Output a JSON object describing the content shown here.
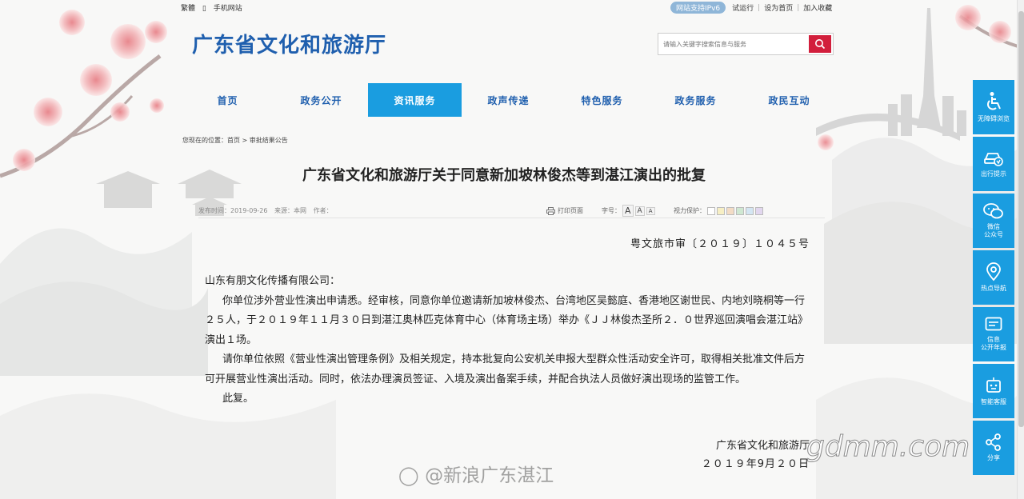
{
  "topbar": {
    "traditional": "繁體",
    "mobile": "手机网站"
  },
  "topright": {
    "ipv6": "网站支持IPv6",
    "trial": "试运行",
    "homepage": "设为首页",
    "favorite": "加入收藏"
  },
  "site": {
    "title": "广东省文化和旅游厅"
  },
  "search": {
    "placeholder": "请输入关键字搜索信息与服务"
  },
  "nav": {
    "items": [
      {
        "label": "首页"
      },
      {
        "label": "政务公开"
      },
      {
        "label": "资讯服务"
      },
      {
        "label": "政声传递"
      },
      {
        "label": "特色服务"
      },
      {
        "label": "政务服务"
      },
      {
        "label": "政民互动"
      }
    ],
    "active_index": 2
  },
  "breadcrumb": {
    "prefix": "您现在的位置：",
    "home": "首页",
    "sep": ">",
    "current": "审批结果公告"
  },
  "article": {
    "title": "广东省文化和旅游厅关于同意新加坡林俊杰等到湛江演出的批复",
    "date": "发布时间：2019-09-26",
    "source": "来源：本网",
    "author": "作者：",
    "print": "打印页面",
    "fontsize": "字号：",
    "font_a1": "A",
    "font_a2": "A",
    "font_a3": "A",
    "vision": "视力保护：",
    "vision_colors": [
      "#ffffff",
      "#f7efc4",
      "#f3dcc5",
      "#cfe8d2",
      "#d4e6f3",
      "#e2d7ef"
    ],
    "doc_no": "粤文旅市审〔２０１９〕１０４５号",
    "p1": "山东有朋文化传播有限公司：",
    "p2": "你单位涉外营业性演出申请悉。经审核，同意你单位邀请新加坡林俊杰、台湾地区吴懿庭、香港地区谢世民、内地刘晓桐等一行２５人，于２０１９年１１月３０日到湛江奥林匹克体育中心（体育场主场）举办《ＪＪ林俊杰圣所２．０世界巡回演唱会湛江站》演出１场。",
    "p3": "请你单位依照《营业性演出管理条例》及相关规定，持本批复向公安机关申报大型群众性活动安全许可，取得相关批准文件后方可开展营业性演出活动。同时，依法办理演员签证、入境及演出备案手续，并配合执法人员做好演出现场的监管工作。",
    "p4": "此复。",
    "sign_org": "广东省文化和旅游厅",
    "sign_date": "２０１９年9月２０日"
  },
  "watermark": {
    "weibo": "@新浪广东湛江",
    "site": "gdmm.com"
  },
  "side": {
    "items": [
      {
        "label": "无障碍浏览",
        "icon": "accessibility-icon"
      },
      {
        "label": "出行提示",
        "icon": "car-icon"
      },
      {
        "label": "微信\n公众号",
        "icon": "wechat-icon"
      },
      {
        "label": "热点导航",
        "icon": "location-icon"
      },
      {
        "label": "信息\n公开年报",
        "icon": "report-icon"
      },
      {
        "label": "智能客服",
        "icon": "robot-icon"
      },
      {
        "label": "分享",
        "icon": "share-icon"
      }
    ]
  },
  "colors": {
    "brand": "#1f5fae",
    "nav_active": "#1a9de0",
    "search_button": "#d21f3c",
    "sidebar": "#1a9de0"
  }
}
